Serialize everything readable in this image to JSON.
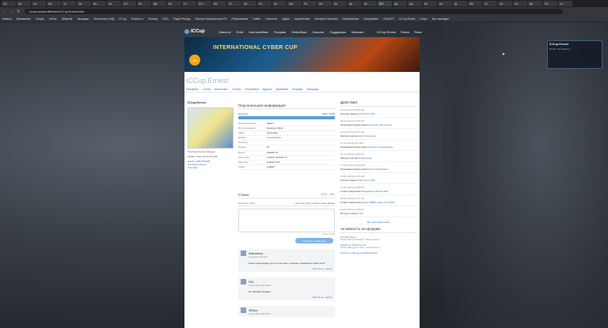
{
  "browser": {
    "tabs": [
      "Ho",
      "Sp",
      "Ho",
      "Mo",
      "To",
      "Ho",
      "Во",
      "Ла",
      "iCC",
      "Ра",
      "ДФ",
      "Бе",
      "Гл",
      "ICC",
      "Mo",
      "Gi",
      "De",
      "Fa",
      "Бе",
      "Ма",
      "Ра",
      "Ип",
      "Ка",
      "Ар",
      "Ко",
      "iCC",
      "Ag",
      "Ад",
      "Бо",
      "Ас",
      "Ig",
      "Wo",
      "Gr",
      "Но",
      "Со",
      "Во",
      "Ра",
      "Со"
    ],
    "url": "iccup.com/profile/view/ICCup.Ernest.html",
    "bookmarks": [
      "Mailbox",
      "Выживание",
      "Google",
      "Online",
      "QSignals",
      "Закладки",
      "Население в МД",
      "iCCup",
      "SmDuo.ro",
      "Picnicky",
      "ИРЦ",
      "Радио Рекорд",
      "Русское Музыкальное Ра",
      "Образование",
      "Twitter",
      "Facebook",
      "Аудио",
      "AppleHeader",
      "Интернет Магазин",
      "Образование",
      "DeepWalker",
      "ChatGPT",
      "iCCup Ernest",
      "Спорт",
      "Все закладки"
    ]
  },
  "site": {
    "logo": "ICCup",
    "menu": [
      "Новости",
      "DotA",
      "Кастомгеймы",
      "Форумы",
      "Инфобаза",
      "Скачать",
      "Поддержка",
      "Магазин"
    ],
    "right": [
      "ICCup.Ernest",
      "Поиск",
      "Язык"
    ]
  },
  "banner": {
    "title": "INTERNATIONAL CYBER CUP",
    "badge": "24"
  },
  "userbox": {
    "name": "ICCup.Ernest",
    "status": "Ботов: 20  Серий: 0"
  },
  "profile": {
    "title": "iCCup.Ernest",
    "tabs": [
      "Профиль",
      "Стена",
      "Мастхэвст",
      "Услуги",
      "Настройки",
      "Друзья",
      "Действия",
      "Форумы",
      "Награды"
    ],
    "name": "ICCup.Ernest",
    "meta": [
      "Trial Shop Service Manager",
      "Баланс: Votes: ₪ 10,107 EXP",
      "кар-аз: 1,184,178 EXP"
    ],
    "links": [
      "Игровой профиль",
      "Лентовка"
    ]
  },
  "personal": {
    "section": "Персональная информация",
    "energy_label": "Энергия",
    "energy_value": "5400 / 5400",
    "rows": [
      {
        "k": "Имя пользователя",
        "v": "Эрнест"
      },
      {
        "k": "Местоположение",
        "v": "Беларусь, Minsk"
      },
      {
        "k": "Скайп",
        "v": "ernest 2011"
      },
      {
        "k": "Website",
        "v": "ernestkleinsfinn"
      },
      {
        "k": "Интересы",
        "v": ""
      },
      {
        "k": "Возраст",
        "v": "26"
      },
      {
        "k": "Вконте",
        "v": "25/06/97 07"
      },
      {
        "k": "Компьютер",
        "v": "Logitech G9 Racer III"
      },
      {
        "k": "Наушники",
        "v": "Logitech G7X"
      },
      {
        "k": "Геймы",
        "v": "Logitech"
      }
    ]
  },
  "wall": {
    "section": "Стена",
    "pager": "1 2 3 ... 74 »",
    "clear": "Очистить стену",
    "note": "Не стоит могут писать только друзья",
    "counter": "доступно 300",
    "post_label": "Оставить сообщение",
    "posts": [
      {
        "author": "WildcatArma...",
        "date": "Сегодня в 16:32 EAT",
        "text": "Сам создам ведем для в это на тами, хорошее с вжаными и работой x3",
        "action": "ответить на  ·  удалить"
      },
      {
        "author": "PAD",
        "date": "11 Sep 2024 в 18:42 EAT",
        "text": "Не забывай награды",
        "action": "ответить на  ·  удалить"
      },
      {
        "author": "iDRipAs",
        "date": "11 Sep 2024 в 18:42 EAT",
        "text": "",
        "action": ""
      }
    ]
  },
  "actions": {
    "section": "Действия",
    "events": [
      {
        "d": "13 Aug 2024 @ 09:55 EAT",
        "t": "Получил медаль",
        "l": "Admin Tour 2024"
      },
      {
        "d": "09 Aug 2024 @ 16:15 EAT",
        "t": "Прокомментировал новость",
        "l": "Игровое Обновление"
      },
      {
        "d": "04 Aug 2024 @ 20:37 EAT",
        "t": "Загрузил реплей",
        "l": "admin-icb-game-2"
      },
      {
        "d": "07 Jul 2024 @ 22:32 EAT",
        "t": "Прокомментировал новость",
        "l": "Custom Closed Games"
      },
      {
        "d": "19 Jun 2024 @ 16:35 EAT",
        "t": "Загрузил реплей",
        "l": "Сохраненное"
      },
      {
        "d": "17 May 2024 @ 01:45 EAT",
        "t": "Прокомментировал новость",
        "l": "DotA Tournaments"
      },
      {
        "d": "13 Mar 2024 @ 02:34 EAT",
        "t": "Получил медаль",
        "l": "Admin Tour 2024"
      },
      {
        "d": "13 Jan 2024 @ 10:08 EAT",
        "t": "Создал новую Ники",
        "l": "Медиадарк новостей 2024"
      },
      {
        "d": "26 Dec 2023 @ 11:57 EAT",
        "t": "Создал новую Ники",
        "l": "Деньги iNEWS новостей за 2024"
      },
      {
        "d": "11 Dec 2023 @ 11:39 EAT",
        "t": "Вступил в клан",
        "l": "Ernest"
      }
    ],
    "all_link": "Все действия юзера"
  },
  "forum": {
    "section": "Активность на форуме",
    "items": [
      {
        "l": "Survival Chaos",
        "s": "26 Nov 2024 @ 05:23 EAT · Новостроитель"
      },
      {
        "l": "Website by WC03 Top 10",
        "s": "26 Nov 2024 @ 06:17 EAT · Новостроитель"
      },
      {
        "l": "Контакты и Форма для Вакансий DL",
        "s": ""
      }
    ]
  }
}
